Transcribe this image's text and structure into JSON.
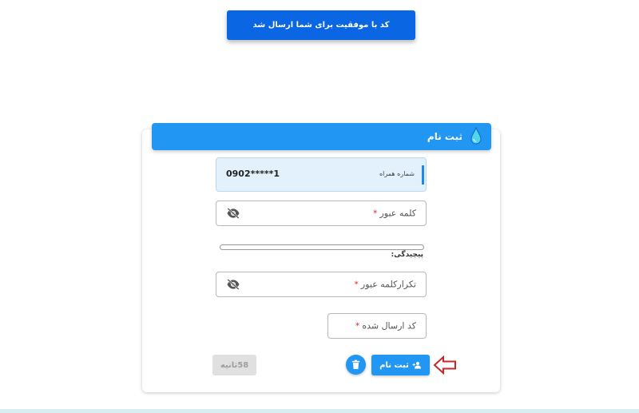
{
  "toast": {
    "message": "کد با موفقیت برای شما ارسال شد"
  },
  "card": {
    "title": "ثبت نام"
  },
  "form": {
    "phone": {
      "label": "شماره همراه",
      "value": "0902*****1"
    },
    "password": {
      "label": "کلمه عبور",
      "required_mark": "*"
    },
    "strength": {
      "label": "پیچیدگی:",
      "value": 0
    },
    "confirm_password": {
      "label": "تکرارکلمه عبور",
      "required_mark": "*"
    },
    "code": {
      "label": "کد ارسال شده",
      "required_mark": "*"
    }
  },
  "actions": {
    "register_label": "ثبت نام",
    "timer_label": "58ثانیه"
  },
  "colors": {
    "primary": "#2196f3",
    "toast": "#0a66e2",
    "arrow": "#c62828",
    "required": "#d32f2f"
  },
  "icons": {
    "logo": "drop-logo-icon",
    "eye_hidden": "eye-off-icon",
    "add_user": "user-plus-icon",
    "trash": "trash-icon",
    "arrow": "arrow-left-outline-icon"
  }
}
